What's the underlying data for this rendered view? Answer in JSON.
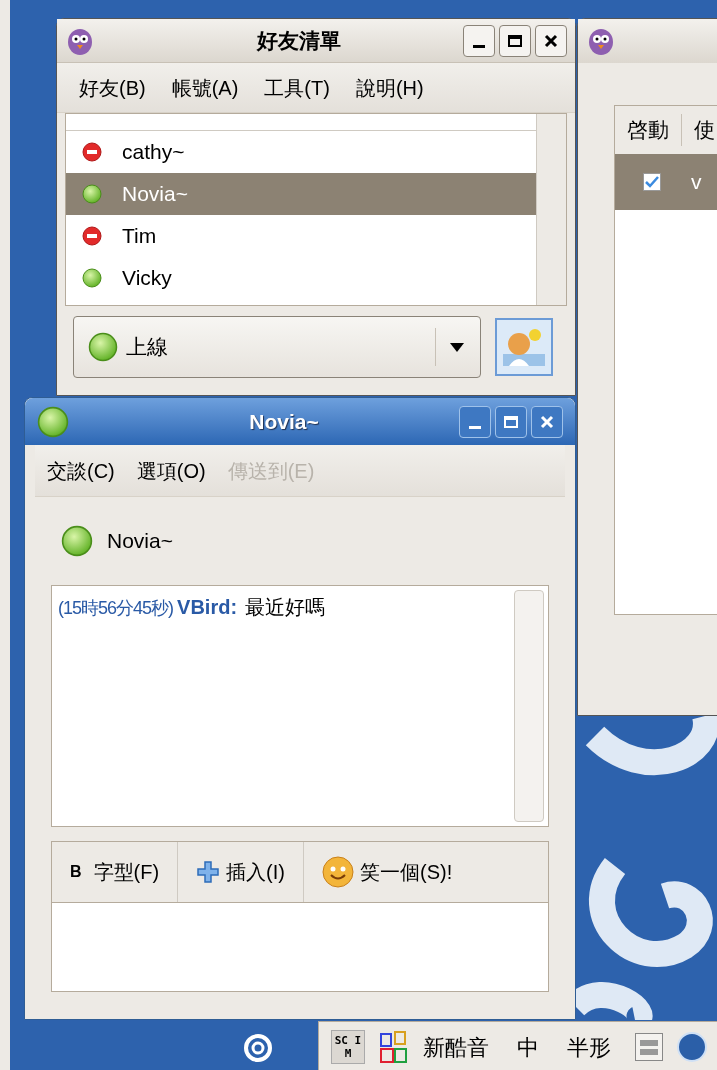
{
  "buddy_window": {
    "title": "好友清單",
    "menu": [
      "好友(B)",
      "帳號(A)",
      "工具(T)",
      "說明(H)"
    ],
    "buddies": [
      {
        "name": "cathy~",
        "kind": "away",
        "selected": false
      },
      {
        "name": "Novia~",
        "kind": "available",
        "selected": true
      },
      {
        "name": "Tim",
        "kind": "away",
        "selected": false
      },
      {
        "name": "Vicky",
        "kind": "available",
        "selected": false
      }
    ],
    "status_selector": {
      "label": "上線",
      "kind": "available"
    }
  },
  "accounts_window": {
    "columns": [
      "啓動",
      "使"
    ],
    "rows": [
      {
        "enabled": true,
        "column_2": "v",
        "selected": true
      }
    ]
  },
  "chat_window": {
    "title": "Novia~",
    "menu": [
      {
        "label": "交談(C)",
        "disabled": false
      },
      {
        "label": "選項(O)",
        "disabled": false
      },
      {
        "label": "傳送到(E)",
        "disabled": true
      }
    ],
    "buddy": {
      "name": "Novia~",
      "kind": "available"
    },
    "messages": [
      {
        "time": "(15時56分45秒)",
        "sender": "VBird:",
        "text": "最近好嗎"
      }
    ],
    "toolbar": [
      {
        "kind": "font",
        "icon_text": "B",
        "label": "字型(F)"
      },
      {
        "kind": "insert",
        "label": "插入(I)"
      },
      {
        "kind": "smiley",
        "label": "笑一個(S)!"
      }
    ]
  },
  "tray": {
    "scim_icon_text": "SC IM",
    "items": [
      "新酷音",
      "中",
      "半形"
    ]
  }
}
